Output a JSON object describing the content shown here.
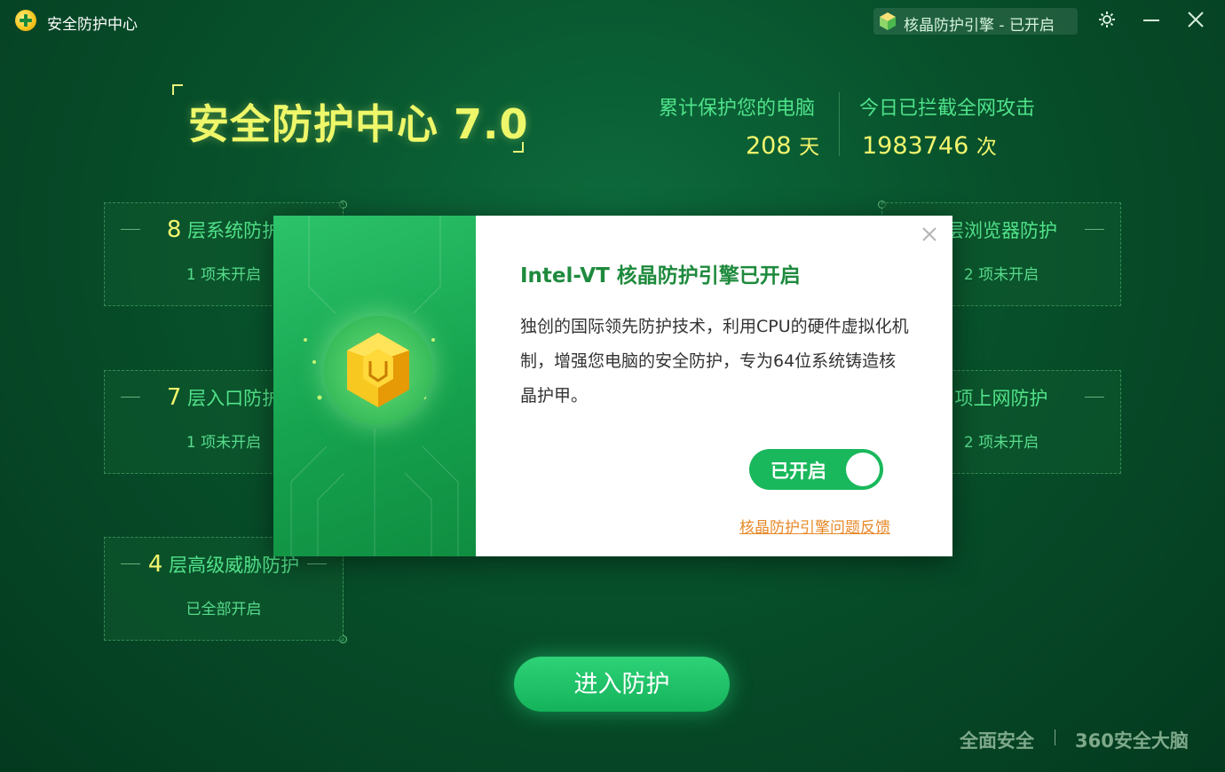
{
  "titlebar": {
    "app_title": "安全防护中心",
    "engine_status": "核晶防护引擎 - 已开启",
    "icons": [
      "settings-gear-icon",
      "minimize-icon",
      "close-icon"
    ]
  },
  "hero": {
    "title": "安全防护中心 7.0",
    "stats": [
      {
        "label": "累计保护您的电脑",
        "value": "208",
        "unit": "天"
      },
      {
        "label": "今日已拦截全网攻击",
        "value": "1983746",
        "unit": "次"
      }
    ]
  },
  "layers": [
    {
      "num": "8",
      "title": "层系统防护",
      "status": "1 项未开启"
    },
    {
      "num": "",
      "title": "层浏览器防护",
      "status": "2 项未开启"
    },
    {
      "num": "7",
      "title": "层入口防护",
      "status": "1 项未开启"
    },
    {
      "num": "",
      "title": "项上网防护",
      "status": "2 项未开启"
    },
    {
      "num": "4",
      "title": "层高级威胁防护",
      "status": "已全部开启"
    }
  ],
  "enter_button": "进入防护",
  "footer": {
    "left": "全面安全",
    "right": "360安全大脑"
  },
  "dialog": {
    "title": "Intel-VT 核晶防护引擎已开启",
    "body": "独创的国际领先防护技术，利用CPU的硬件虚拟化机制，增强您电脑的安全防护，专为64位系统铸造核晶护甲。",
    "toggle_label": "已开启",
    "toggle_on": true,
    "feedback_link": "核晶防护引擎问题反馈"
  },
  "colors": {
    "accent_green": "#1ab85c",
    "highlight_yellow": "#f3f56d",
    "link_orange": "#e8892a",
    "title_green": "#1e8a3d"
  }
}
